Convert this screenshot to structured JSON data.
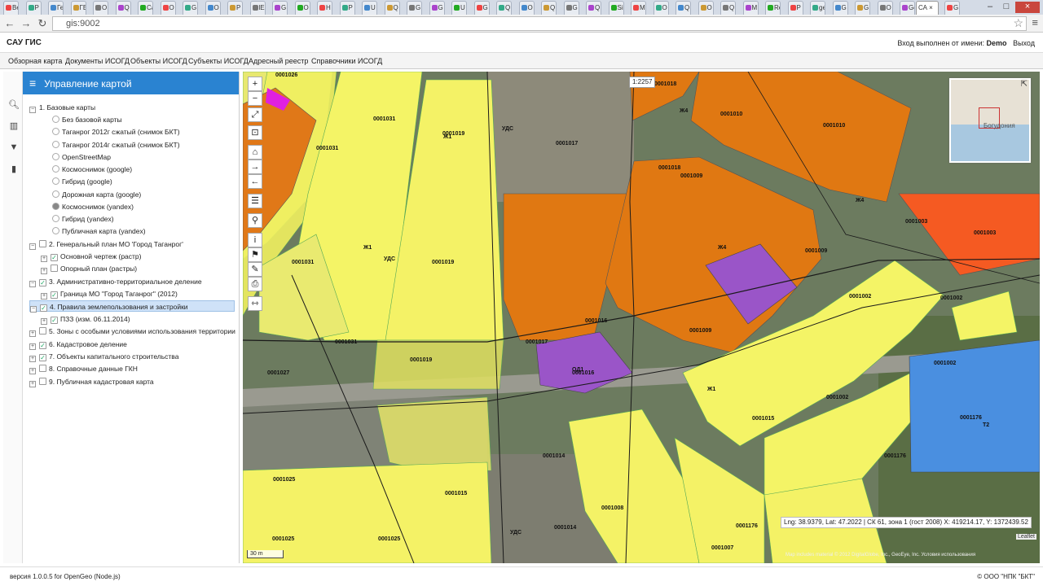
{
  "browser": {
    "tab_labels": [
      "Ве",
      "Р",
      "Ге",
      "ГЕ",
      "О",
      "Q",
      "Са",
      "О",
      "G",
      "О",
      "Р",
      "lЕ",
      "G",
      "О",
      "Н",
      "Р",
      "U",
      "Q",
      "G",
      "G",
      "U",
      "G",
      "Q",
      "О",
      "Q",
      "G",
      "Q",
      "Si",
      "М",
      "О",
      "Q",
      "О",
      "Q",
      "М",
      "Re",
      "Р",
      "ge",
      "G",
      "G",
      "О",
      "Ge",
      "G",
      "G"
    ],
    "active_tab_label": "СА",
    "close_glyph": "×",
    "url": "gis:9002"
  },
  "app": {
    "title": "САУ ГИС",
    "login_prefix": "Вход выполнен от имени:",
    "user": "Demo",
    "logout": "Выход"
  },
  "nav": {
    "items": [
      "Обзорная карта",
      "Документы ИСОГД",
      "Объекты ИСОГД",
      "Субъекты ИСОГД",
      "Адресный реестр",
      "Справочники ИСОГД"
    ]
  },
  "panel": {
    "title": "Управление картой",
    "basemaps_group": "1. Базовые карты",
    "basemaps": [
      "Без базовой карты",
      "Таганрог 2012г сжатый (снимок БКТ)",
      "Таганрог 2014г сжатый (снимок БКТ)",
      "OpenStreetMap",
      "Космоснимок (google)",
      "Гибрид (google)",
      "Дорожная карта (google)",
      "Космоснимок (yandex)",
      "Гибрид (yandex)",
      "Публичная карта (yandex)"
    ],
    "group2": "2. Генеральный план МО 'Город Таганрог'",
    "group2_children": [
      "Основной чертеж (растр)",
      "Опорный план (растры)"
    ],
    "group3": "3. Административно-территориальное деление",
    "group3_child": "Граница МО \"Город Таганрог\" (2012)",
    "group4": "4. Правила землепользования и застройки",
    "group4_child": "ПЗЗ (изм. 06.11.2014)",
    "group5": "5. Зоны с особыми условиями использования территории",
    "group6": "6. Кадастровое деление",
    "group7": "7. Объекты капитального строительства",
    "group8": "8. Справочные данные ГКН",
    "group9": "9. Публичная кадастровая карта"
  },
  "map": {
    "scale": "1:2257",
    "minimap_label": "Богудония",
    "coords": "Lng: 38.9379, Lat: 47.2022 | СК 61, зона 1 (гост 2008) X: 419214.17, Y: 1372439.52",
    "scalebar": "30 m",
    "attribution": "Map includes material © 2012 DigitalGlobe, Inc., GeoEye, Inc. Условия использования",
    "leaflet": "Leaflet",
    "labels": [
      {
        "t": "0001026"
      },
      {
        "t": "0001031"
      },
      {
        "t": "0001031"
      },
      {
        "t": "0001031"
      },
      {
        "t": "0001031"
      },
      {
        "t": "0001019"
      },
      {
        "t": "0001019"
      },
      {
        "t": "0001019"
      },
      {
        "t": "0001017"
      },
      {
        "t": "0001017"
      },
      {
        "t": "0001018"
      },
      {
        "t": "0001018"
      },
      {
        "t": "0001010"
      },
      {
        "t": "0001010"
      },
      {
        "t": "0001009"
      },
      {
        "t": "0001009"
      },
      {
        "t": "0001009"
      },
      {
        "t": "0001003"
      },
      {
        "t": "0001003"
      },
      {
        "t": "0001002"
      },
      {
        "t": "0001002"
      },
      {
        "t": "0001002"
      },
      {
        "t": "0001002"
      },
      {
        "t": "0001016"
      },
      {
        "t": "0001016"
      },
      {
        "t": "0001015"
      },
      {
        "t": "0001015"
      },
      {
        "t": "0001014"
      },
      {
        "t": "0001014"
      },
      {
        "t": "0001025"
      },
      {
        "t": "0001025"
      },
      {
        "t": "0001025"
      },
      {
        "t": "0001008"
      },
      {
        "t": "0001007"
      },
      {
        "t": "0001176"
      },
      {
        "t": "0001176"
      },
      {
        "t": "0001176"
      },
      {
        "t": "0001027"
      },
      {
        "t": "Ж1"
      },
      {
        "t": "Ж1"
      },
      {
        "t": "Ж1"
      },
      {
        "t": "Ж4"
      },
      {
        "t": "Ж4"
      },
      {
        "t": "Ж4"
      },
      {
        "t": "Т2"
      },
      {
        "t": "ОД1"
      },
      {
        "t": "УДС"
      },
      {
        "t": "УДС"
      },
      {
        "t": "УДС"
      }
    ]
  },
  "footer": {
    "version": "версия 1.0.0.5 for OpenGeo (Node.js)",
    "copyright": "© ООО \"НПК \"БКТ\""
  }
}
